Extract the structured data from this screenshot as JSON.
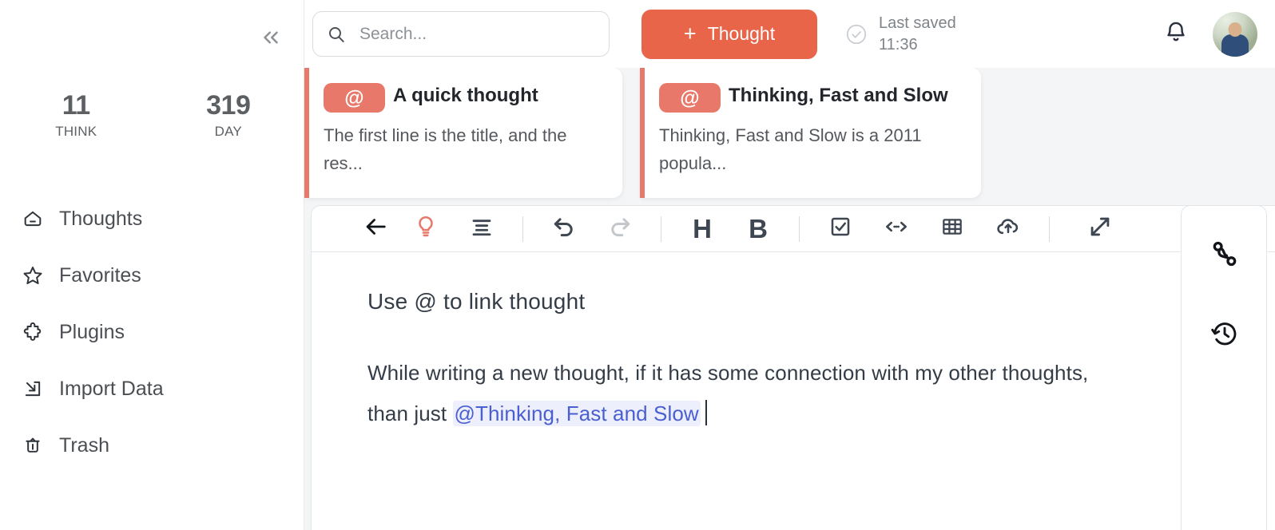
{
  "sidebar": {
    "collapse_icon": "chevrons-left-icon",
    "stats": [
      {
        "value": "11",
        "label": "THINK"
      },
      {
        "value": "319",
        "label": "DAY"
      }
    ],
    "items": [
      {
        "label": "Thoughts",
        "icon": "home-icon"
      },
      {
        "label": "Favorites",
        "icon": "star-icon"
      },
      {
        "label": "Plugins",
        "icon": "puzzle-icon"
      },
      {
        "label": "Import Data",
        "icon": "import-icon"
      },
      {
        "label": "Trash",
        "icon": "trash-icon"
      }
    ]
  },
  "topbar": {
    "search": {
      "placeholder": "Search...",
      "value": "",
      "icon": "search-icon"
    },
    "new_thought_button": {
      "plus": "+",
      "label": "Thought",
      "color": "#e8654a"
    },
    "saved": {
      "icon": "check-circle-icon",
      "line1": "Last saved",
      "line2": "11:36"
    },
    "bell_icon": "bell-icon",
    "avatar": "user-avatar"
  },
  "suggestions": [
    {
      "badge": "@",
      "title": "A quick thought",
      "preview": "The first line is the title, and the res..."
    },
    {
      "badge": "@",
      "title": "Thinking, Fast and Slow",
      "preview": "Thinking, Fast and Slow is a 2011 popula..."
    }
  ],
  "editor": {
    "toolbar": [
      {
        "name": "back-arrow-icon",
        "label": ""
      },
      {
        "name": "lightbulb-icon",
        "label": ""
      },
      {
        "name": "align-left-icon",
        "label": ""
      },
      {
        "name": "undo-icon",
        "label": ""
      },
      {
        "name": "redo-icon",
        "label": ""
      },
      {
        "name": "heading-icon",
        "label": "H"
      },
      {
        "name": "bold-icon",
        "label": "B"
      },
      {
        "name": "checkbox-icon",
        "label": ""
      },
      {
        "name": "code-icon",
        "label": ""
      },
      {
        "name": "table-icon",
        "label": ""
      },
      {
        "name": "cloud-upload-icon",
        "label": ""
      },
      {
        "name": "expand-icon",
        "label": ""
      }
    ],
    "title": "Use @ to link thought",
    "body_before": "While writing a new thought, if it has some connection with my other thoughts, than just ",
    "mention": "@Thinking, Fast and Slow",
    "mention_color": "#4a5fd0",
    "mention_bg": "#edeffc"
  },
  "right_rail": {
    "buttons": [
      {
        "icon": "connections-icon"
      },
      {
        "icon": "history-icon"
      }
    ]
  }
}
